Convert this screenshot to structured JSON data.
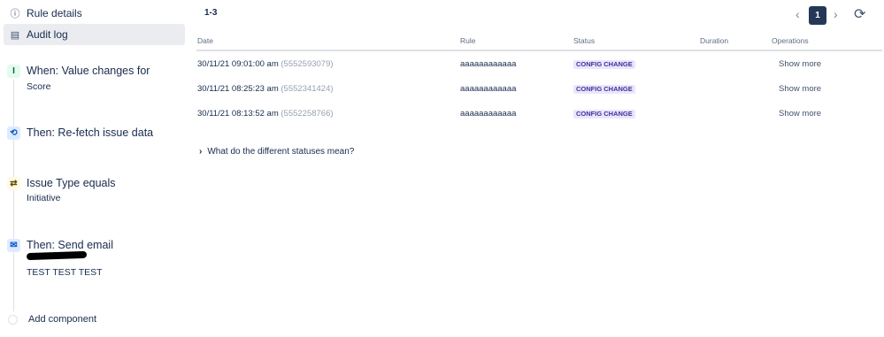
{
  "sidebar": {
    "nav": [
      {
        "label": "Rule details",
        "icon": "info-icon"
      },
      {
        "label": "Audit log",
        "icon": "document-icon"
      }
    ],
    "components": [
      {
        "kind": "trigger",
        "icon": "value-change-icon",
        "title": "When: Value changes for",
        "sub": "Score"
      },
      {
        "kind": "action",
        "icon": "refresh-icon",
        "title": "Then: Re-fetch issue data",
        "sub": ""
      },
      {
        "kind": "condition",
        "icon": "shuffle-icon",
        "title": "Issue Type equals",
        "sub": "Initiative"
      },
      {
        "kind": "action",
        "icon": "mail-icon",
        "title": "Then: Send email",
        "sub": "TEST TEST TEST"
      }
    ],
    "add_component": "Add component"
  },
  "main": {
    "range": "1-3",
    "pagination": {
      "current": "1"
    },
    "columns": [
      "Date",
      "Rule",
      "Status",
      "Duration",
      "Operations"
    ],
    "rows": [
      {
        "date": "30/11/21 09:01:00 am",
        "id": "(5552593079)",
        "rule": "aaaaaaaaaaaa",
        "status": "CONFIG CHANGE",
        "duration": "",
        "op": "Show more"
      },
      {
        "date": "30/11/21 08:25:23 am",
        "id": "(5552341424)",
        "rule": "aaaaaaaaaaaa",
        "status": "CONFIG CHANGE",
        "duration": "",
        "op": "Show more"
      },
      {
        "date": "30/11/21 08:13:52 am",
        "id": "(5552258766)",
        "rule": "aaaaaaaaaaaa",
        "status": "CONFIG CHANGE",
        "duration": "",
        "op": "Show more"
      }
    ],
    "expander": "What do the different statuses mean?"
  },
  "colors": {
    "accent": "#253858",
    "status_bg": "#eae6ff",
    "status_fg": "#403294"
  }
}
